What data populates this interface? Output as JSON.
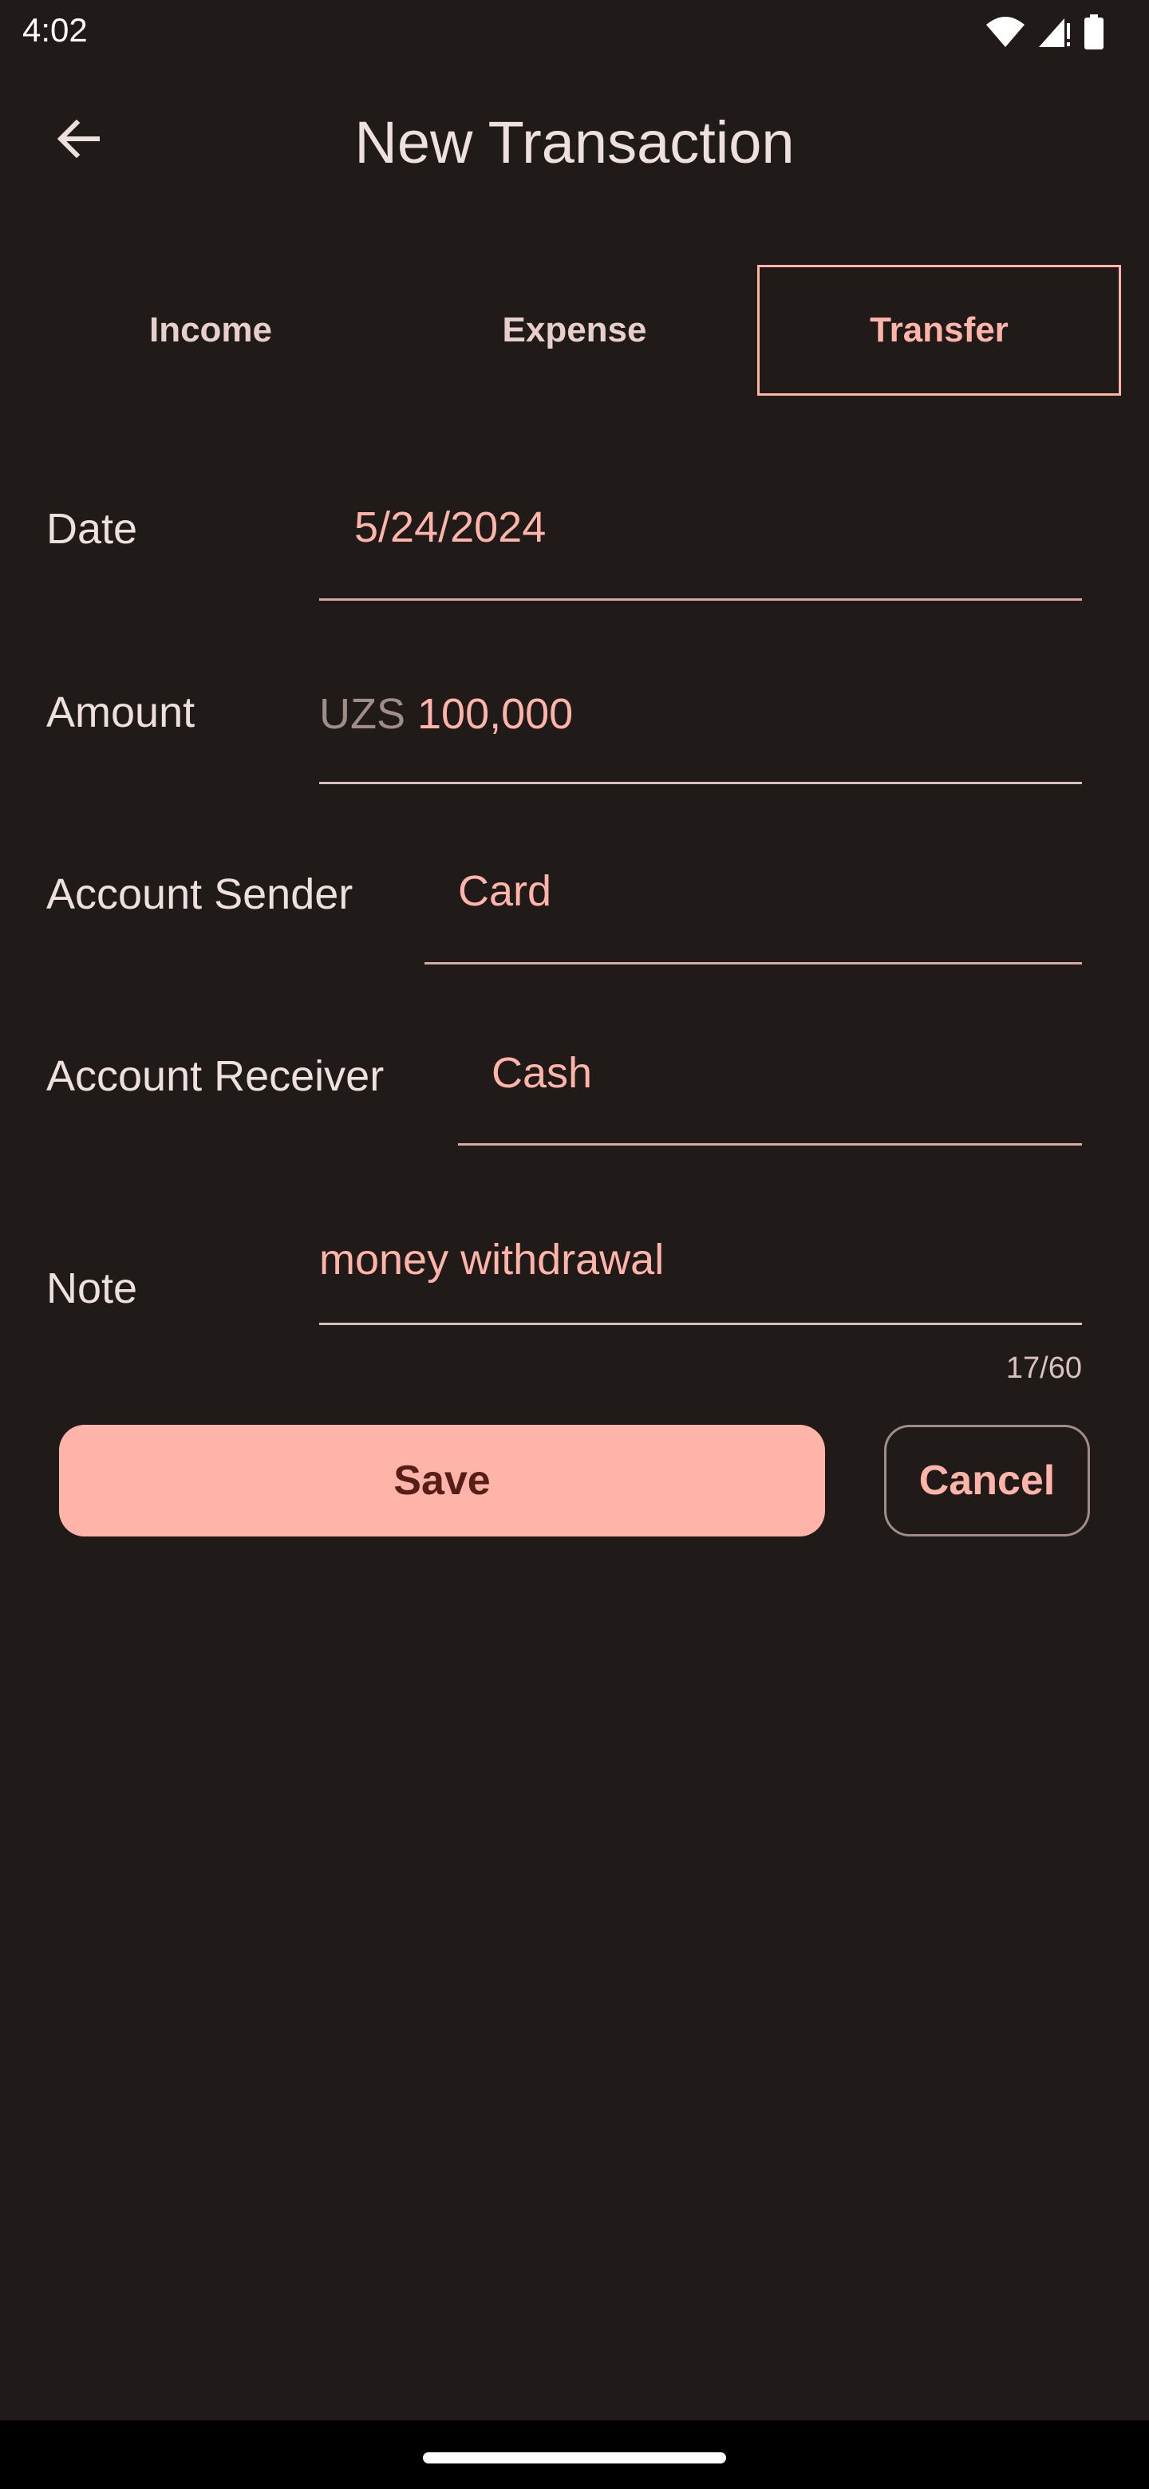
{
  "status_bar": {
    "time": "4:02"
  },
  "app_bar": {
    "title": "New Transaction",
    "back_icon": "arrow-back-icon"
  },
  "type_tabs": [
    {
      "label": "Income",
      "selected": false
    },
    {
      "label": "Expense",
      "selected": false
    },
    {
      "label": "Transfer",
      "selected": true
    }
  ],
  "form": {
    "date": {
      "label": "Date",
      "value": "5/24/2024"
    },
    "amount": {
      "label": "Amount",
      "prefix": "UZS",
      "value": "100,000"
    },
    "account_sender": {
      "label": "Account Sender",
      "value": "Card"
    },
    "account_receiver": {
      "label": "Account Receiver",
      "value": "Cash"
    },
    "note": {
      "label": "Note",
      "value": "money withdrawal",
      "counter": "17/60"
    }
  },
  "actions": {
    "save_label": "Save",
    "cancel_label": "Cancel"
  },
  "colors": {
    "background": "#201a19",
    "accent": "#ffb4a9",
    "on_accent": "#561e16"
  }
}
